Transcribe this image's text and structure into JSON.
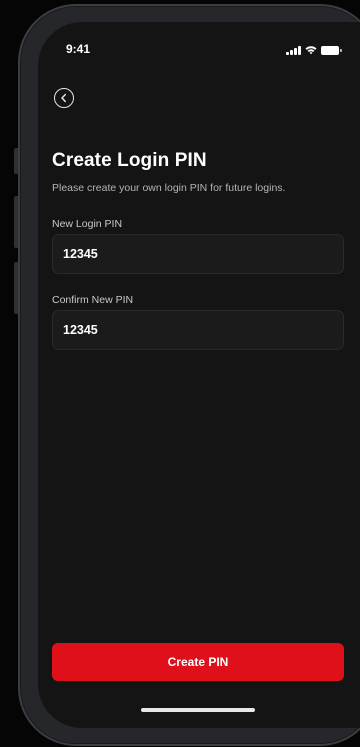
{
  "status_bar": {
    "time": "9:41",
    "icons": [
      "cellular-signal-icon",
      "wifi-icon",
      "battery-icon"
    ]
  },
  "header": {
    "back_icon": "chevron-left-circle-icon",
    "title": "Create Login PIN",
    "subtitle": "Please create your own login PIN for future logins."
  },
  "form": {
    "new_pin": {
      "label": "New Login PIN",
      "value": "12345"
    },
    "confirm_pin": {
      "label": "Confirm New PIN",
      "value": "12345"
    }
  },
  "actions": {
    "submit_label": "Create PIN"
  },
  "colors": {
    "background": "#141414",
    "input_background": "#1b1b1b",
    "accent": "#e0101a",
    "text_primary": "#ffffff",
    "text_secondary": "#b4b4b4"
  }
}
